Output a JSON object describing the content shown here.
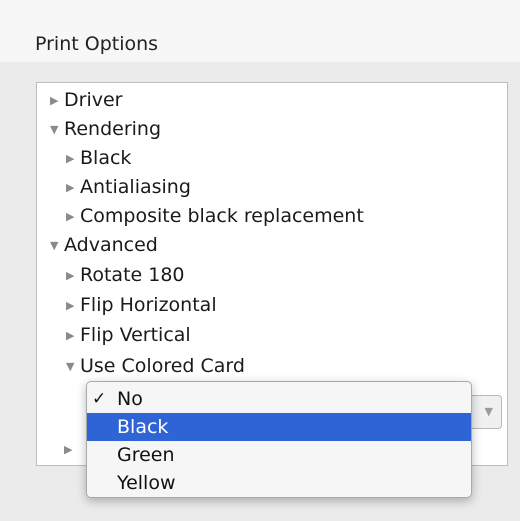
{
  "section": {
    "title": "Print Options"
  },
  "tree": {
    "driver": {
      "label": "Driver",
      "icon": "disclosure-collapsed"
    },
    "rendering": {
      "label": "Rendering",
      "icon": "disclosure-expanded"
    },
    "black": {
      "label": "Black",
      "icon": "disclosure-collapsed"
    },
    "antialiasing": {
      "label": "Antialiasing",
      "icon": "disclosure-collapsed"
    },
    "composite": {
      "label": "Composite black replacement",
      "icon": "disclosure-collapsed"
    },
    "advanced": {
      "label": "Advanced",
      "icon": "disclosure-expanded"
    },
    "rotate": {
      "label": "Rotate 180",
      "icon": "disclosure-collapsed"
    },
    "flip_h": {
      "label": "Flip Horizontal",
      "icon": "disclosure-collapsed"
    },
    "flip_v": {
      "label": "Flip Vertical",
      "icon": "disclosure-collapsed"
    },
    "colored_card": {
      "label": "Use Colored Card",
      "icon": "disclosure-expanded"
    }
  },
  "dropdown": {
    "current_value": "No",
    "options": [
      {
        "label": "No",
        "checked": true,
        "highlighted": false
      },
      {
        "label": "Black",
        "checked": false,
        "highlighted": true
      },
      {
        "label": "Green",
        "checked": false,
        "highlighted": false
      },
      {
        "label": "Yellow",
        "checked": false,
        "highlighted": false
      }
    ],
    "check_glyph": "✓"
  },
  "colors": {
    "highlight": "#2f64d6",
    "panel_background": "#ebebeb",
    "tree_background": "#ffffff"
  }
}
